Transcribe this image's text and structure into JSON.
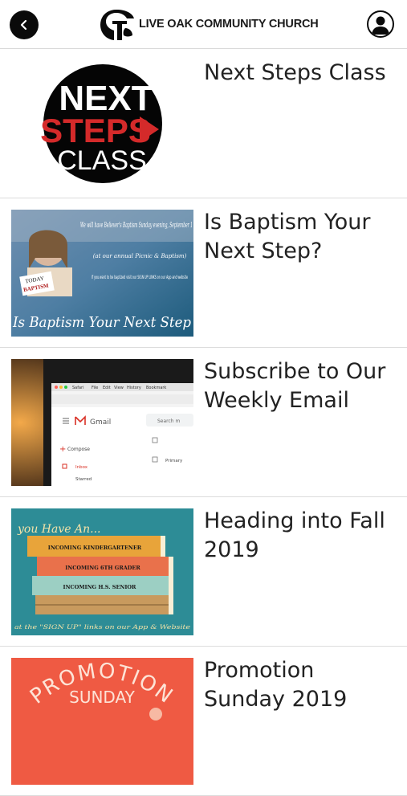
{
  "header": {
    "brand_name": "LIVE OAK COMMUNITY CHURCH",
    "back_icon": "chevron-left-icon",
    "profile_icon": "user-profile-icon"
  },
  "items": [
    {
      "title": "Next Steps Class",
      "thumb": {
        "line1": "NEXT",
        "line2": "STEPS",
        "line3": "CLASS"
      }
    },
    {
      "title": "Is Baptism Your Next Step?",
      "thumb": {
        "script_top": "We will have Believer's Baptism Sunday evening, September 1",
        "script_sub": "(at our annual Picnic & Baptism)",
        "body": "If you want to be baptized visit our SIGN UP LINKS on our App and website",
        "sign_line1": "TODAY",
        "sign_line2": "BAPTISM",
        "footer": "Is Baptism Your Next Step"
      }
    },
    {
      "title": "Subscribe to Our Weekly Email",
      "thumb": {
        "menu_items": [
          "Safari",
          "File",
          "Edit",
          "View",
          "History",
          "Bookmark"
        ],
        "app_name": "Gmail",
        "search_text": "Search m",
        "compose": "Compose",
        "inbox": "Inbox",
        "starred": "Starred",
        "primary": "Primary"
      }
    },
    {
      "title": "Heading into Fall 2019",
      "thumb": {
        "script_top": "you Have An...",
        "book1": "INCOMING KINDERGARTENER",
        "book2": "INCOMING 6TH GRADER",
        "book3": "INCOMING H.S. SENIOR",
        "footer": "at the \"SIGN UP\" links on our App & Website"
      }
    },
    {
      "title": "Promotion Sunday 2019",
      "thumb": {
        "line1": "PROMOTION",
        "line2": "SUNDAY"
      }
    }
  ],
  "colors": {
    "header_bg": "#ffffff",
    "icon_dark": "#0a0a0a",
    "divider": "#dcdcdc",
    "next_steps_red": "#d42a2a",
    "fall_teal": "#2d8c96",
    "promo_orange": "#ef5a43"
  }
}
